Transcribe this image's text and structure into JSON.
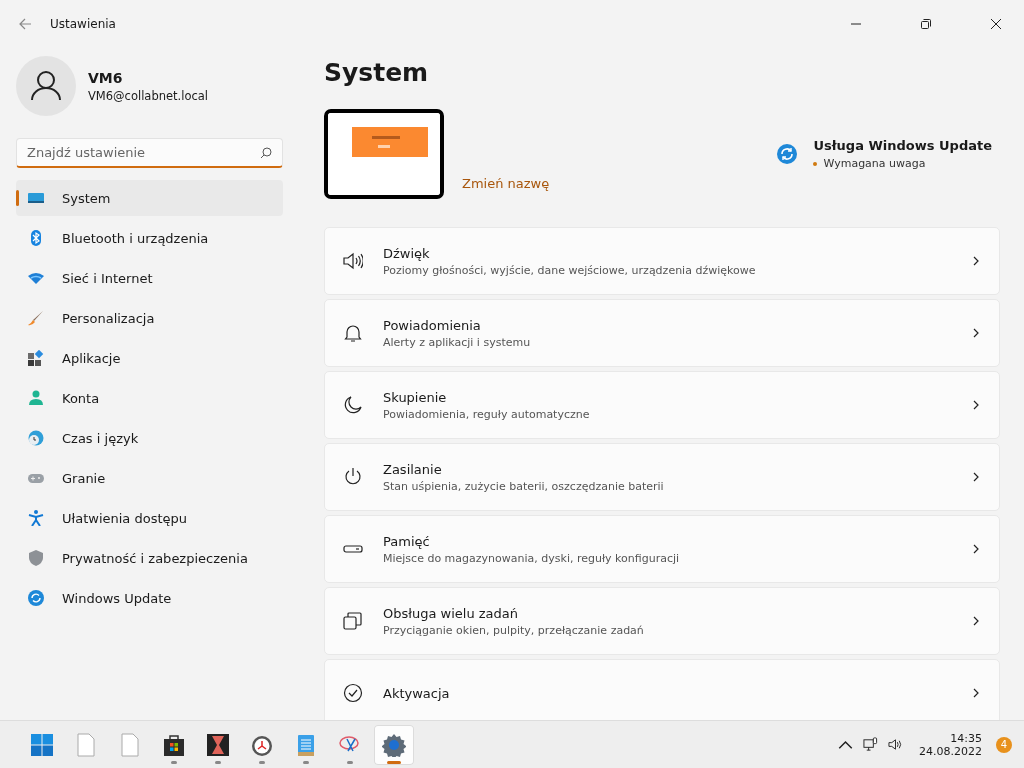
{
  "window": {
    "title": "Ustawienia"
  },
  "account": {
    "name": "VM6",
    "email": "VM6@collabnet.local"
  },
  "search": {
    "placeholder": "Znajdź ustawienie"
  },
  "nav": [
    {
      "label": "System",
      "selected": true
    },
    {
      "label": "Bluetooth i urządzenia",
      "selected": false
    },
    {
      "label": "Sieć i Internet",
      "selected": false
    },
    {
      "label": "Personalizacja",
      "selected": false
    },
    {
      "label": "Aplikacje",
      "selected": false
    },
    {
      "label": "Konta",
      "selected": false
    },
    {
      "label": "Czas i język",
      "selected": false
    },
    {
      "label": "Granie",
      "selected": false
    },
    {
      "label": "Ułatwienia dostępu",
      "selected": false
    },
    {
      "label": "Prywatność i zabezpieczenia",
      "selected": false
    },
    {
      "label": "Windows Update",
      "selected": false
    }
  ],
  "page": {
    "title": "System",
    "rename": "Zmień nazwę",
    "update": {
      "title": "Usługa Windows Update",
      "status": "Wymagana uwaga"
    }
  },
  "cards": [
    {
      "title": "Dźwięk",
      "desc": "Poziomy głośności, wyjście, dane wejściowe, urządzenia dźwiękowe"
    },
    {
      "title": "Powiadomienia",
      "desc": "Alerty z aplikacji i systemu"
    },
    {
      "title": "Skupienie",
      "desc": "Powiadomienia, reguły automatyczne"
    },
    {
      "title": "Zasilanie",
      "desc": "Stan uśpienia, zużycie baterii, oszczędzanie baterii"
    },
    {
      "title": "Pamięć",
      "desc": "Miejsce do magazynowania, dyski, reguły konfiguracji"
    },
    {
      "title": "Obsługa wielu zadań",
      "desc": "Przyciąganie okien, pulpity, przełączanie zadań"
    },
    {
      "title": "Aktywacja"
    }
  ],
  "taskbar": {
    "apps": [
      {
        "running": false,
        "selected": false
      },
      {
        "running": false,
        "selected": false
      },
      {
        "running": false,
        "selected": false
      },
      {
        "running": true,
        "selected": false
      },
      {
        "running": true,
        "selected": false
      },
      {
        "running": true,
        "selected": false
      },
      {
        "running": true,
        "selected": false
      },
      {
        "running": true,
        "selected": false
      },
      {
        "running": true,
        "selected": true
      }
    ],
    "time": "14:35",
    "date": "24.08.2022",
    "badge": "4"
  }
}
